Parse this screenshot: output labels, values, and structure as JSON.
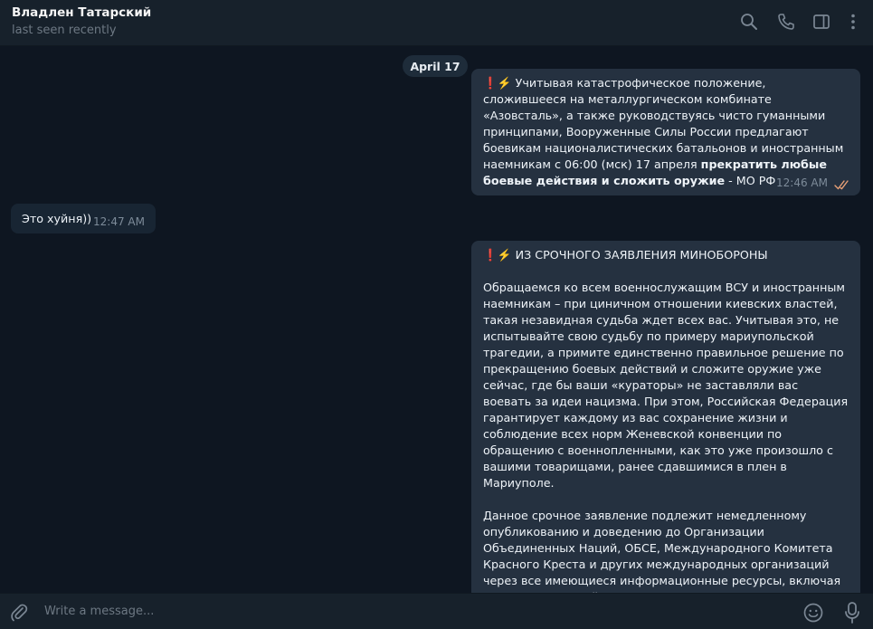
{
  "header": {
    "title": "Владлен Татарский",
    "status": "last seen recently"
  },
  "chat": {
    "date_separator": "April 17",
    "messages": [
      {
        "direction": "out",
        "emoji_prefix": "❗️⚡️",
        "text_plain": " Учитывая катастрофическое положение, сложившееся на металлургическом комбинате «Азовсталь», а также руководствуясь чисто гуманными принципами, Вооруженные Силы России предлагают боевикам националистических батальонов и иностранным наемникам с 06:00 (мск) 17 апреля ",
        "text_bold": "прекратить любые боевые действия и сложить оружие",
        "text_tail": " - МО РФ",
        "time": "12:46 AM",
        "read": true
      },
      {
        "direction": "in",
        "text": "Это хуйня))",
        "time": "12:47 AM"
      },
      {
        "direction": "out",
        "emoji_prefix": "❗️⚡️",
        "heading": " ИЗ СРОЧНОГО ЗАЯВЛЕНИЯ МИНОБОРОНЫ",
        "paragraph1": "Обращаемся ко всем военнослужащим ВСУ и иностранным наемникам – при циничном отношении киевских властей, такая незавидная судьба ждет всех вас. Учитывая это, не испытывайте свою судьбу по примеру мариупольской трагедии, а примите единственно правильное решение по прекращению боевых действий и сложите оружие уже сейчас, где бы ваши «кураторы» не заставляли вас воевать за идеи нацизма. При этом, Российская Федерация гарантирует каждому из вас сохранение жизни и соблюдение всех норм Женевской конвенции по обращению с военнопленными, как это уже произошло с вашими товарищами, ранее сдавшимися в плен в Мариуполе.",
        "paragraph2": "Данное срочное заявление подлежит немедленному опубликованию и доведению до Организации Объединенных Наций, ОБСЕ, Международного Комитета Красного Креста и других международных организаций через все имеющиеся информационные ресурсы, включая средства массовой информации."
      }
    ]
  },
  "input": {
    "placeholder": "Write a message..."
  },
  "icons": {
    "search": "search-icon",
    "call": "phone-icon",
    "sidebar": "sidebar-toggle-icon",
    "menu": "more-vertical-icon",
    "attach": "paperclip-icon",
    "emoji": "emoji-icon",
    "mic": "microphone-icon"
  },
  "colors": {
    "background": "#0e1621",
    "header": "#17212b",
    "bubble_out": "#253140",
    "bubble_in": "#182533",
    "read_checks": "#e8a076",
    "muted_text": "#6d7883"
  }
}
